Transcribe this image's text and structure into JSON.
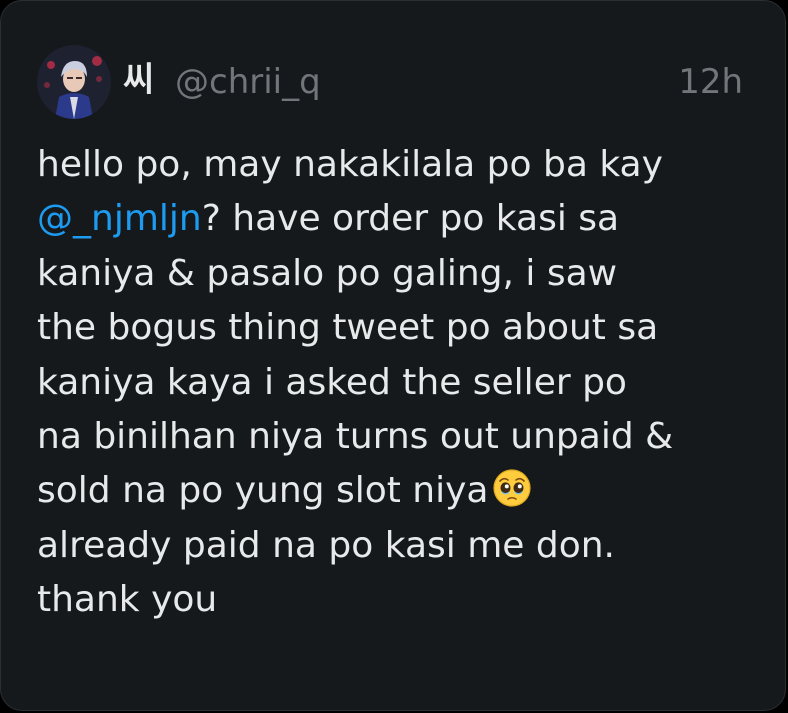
{
  "tweet": {
    "display_name": "씨",
    "handle": "@chrii_q",
    "time": "12h",
    "avatar_icon": "profile-photo",
    "mention": "@_njmljn",
    "emoji_icon": "pleading-face-emoji",
    "lines": [
      "hello po, may nakakilala po ba kay",
      "? have order po kasi sa",
      "kaniya & pasalo po galing, i saw",
      "the bogus thing tweet po about sa",
      "kaniya kaya i asked the seller po",
      "na binilhan niya turns out unpaid &",
      "sold na po yung slot niya",
      "already paid na po kasi me don.",
      "thank you"
    ]
  },
  "colors": {
    "background": "#15191c",
    "text": "#e7e9ea",
    "muted": "#71767b",
    "link": "#1d9bf0"
  }
}
